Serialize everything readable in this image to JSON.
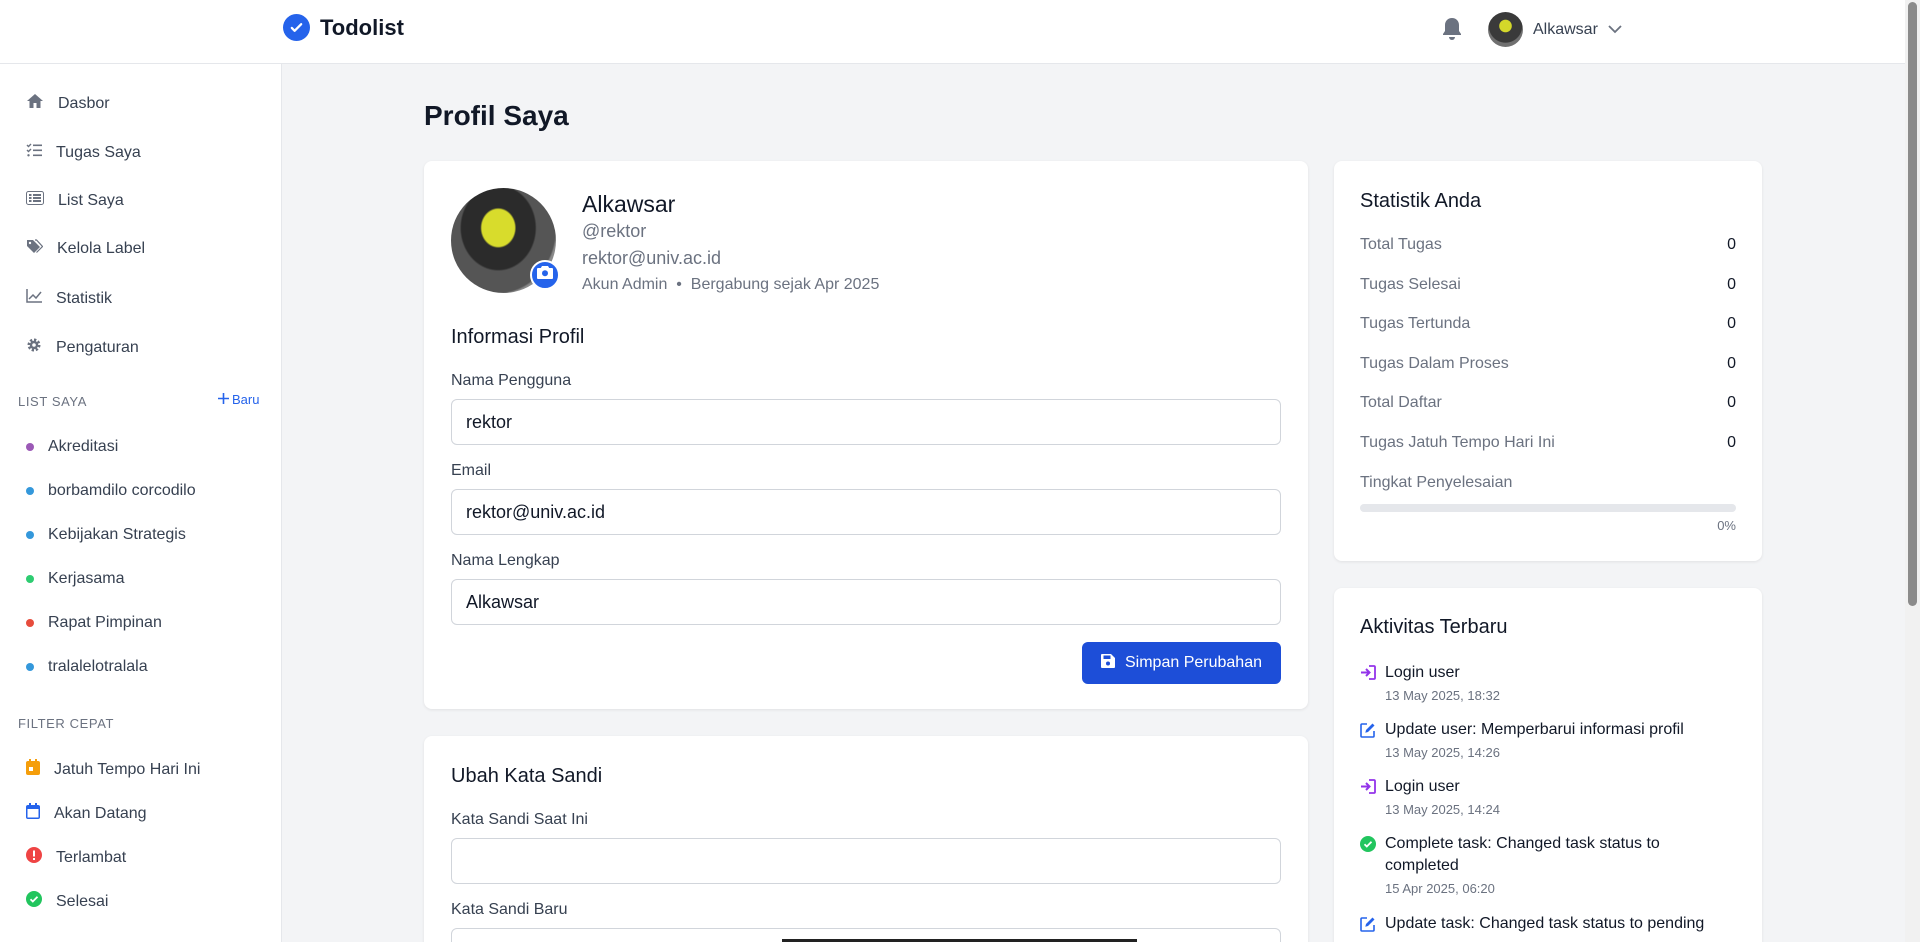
{
  "header": {
    "brand": "Todolist",
    "user_name": "Alkawsar"
  },
  "sidebar": {
    "nav": [
      {
        "label": "Dasbor",
        "icon": "home-icon"
      },
      {
        "label": "Tugas Saya",
        "icon": "tasks-icon"
      },
      {
        "label": "List Saya",
        "icon": "list-icon"
      },
      {
        "label": "Kelola Label",
        "icon": "tags-icon"
      },
      {
        "label": "Statistik",
        "icon": "chart-line-icon"
      },
      {
        "label": "Pengaturan",
        "icon": "gear-icon"
      }
    ],
    "lists_title": "LIST SAYA",
    "new_label": "Baru",
    "lists": [
      {
        "label": "Akreditasi",
        "color": "#9b59b6"
      },
      {
        "label": "borbamdilo corcodilo",
        "color": "#3498db"
      },
      {
        "label": "Kebijakan Strategis",
        "color": "#3498db"
      },
      {
        "label": "Kerjasama",
        "color": "#2ecc71"
      },
      {
        "label": "Rapat Pimpinan",
        "color": "#e74c3c"
      },
      {
        "label": "tralalelotralala",
        "color": "#3498db"
      }
    ],
    "filter_title": "FILTER CEPAT",
    "filters": [
      {
        "label": "Jatuh Tempo Hari Ini",
        "icon": "calendar-day-icon",
        "color": "#f59e0b"
      },
      {
        "label": "Akan Datang",
        "icon": "calendar-icon",
        "color": "#2563eb"
      },
      {
        "label": "Terlambat",
        "icon": "alert-icon",
        "color": "#ef4444"
      },
      {
        "label": "Selesai",
        "icon": "check-circle-icon",
        "color": "#22c55e"
      }
    ]
  },
  "main": {
    "page_title": "Profil Saya",
    "profile": {
      "name": "Alkawsar",
      "username": "@rektor",
      "email": "rektor@univ.ac.id",
      "meta": "Akun Admin  •  Bergabung sejak Apr 2025"
    },
    "info": {
      "title": "Informasi Profil",
      "username_label": "Nama Pengguna",
      "username_value": "rektor",
      "email_label": "Email",
      "email_value": "rektor@univ.ac.id",
      "fullname_label": "Nama Lengkap",
      "fullname_value": "Alkawsar",
      "save_label": "Simpan Perubahan"
    },
    "password": {
      "title": "Ubah Kata Sandi",
      "current_label": "Kata Sandi Saat Ini",
      "new_label": "Kata Sandi Baru"
    }
  },
  "stats": {
    "title": "Statistik Anda",
    "rows": [
      {
        "label": "Total Tugas",
        "value": "0"
      },
      {
        "label": "Tugas Selesai",
        "value": "0"
      },
      {
        "label": "Tugas Tertunda",
        "value": "0"
      },
      {
        "label": "Tugas Dalam Proses",
        "value": "0"
      },
      {
        "label": "Total Daftar",
        "value": "0"
      },
      {
        "label": "Tugas Jatuh Tempo Hari Ini",
        "value": "0"
      }
    ],
    "completion_label": "Tingkat Penyelesaian",
    "completion_percent": 0,
    "completion_text": "0%"
  },
  "activity": {
    "title": "Aktivitas Terbaru",
    "items": [
      {
        "title": "Login user",
        "time": "13 May 2025, 18:32",
        "icon": "sign-in-icon",
        "color": "#9333ea"
      },
      {
        "title": "Update user: Memperbarui informasi profil",
        "time": "13 May 2025, 14:26",
        "icon": "edit-icon",
        "color": "#2563eb"
      },
      {
        "title": "Login user",
        "time": "13 May 2025, 14:24",
        "icon": "sign-in-icon",
        "color": "#9333ea"
      },
      {
        "title": "Complete task: Changed task status to completed",
        "time": "15 Apr 2025, 06:20",
        "icon": "check-circle-icon",
        "color": "#22c55e"
      },
      {
        "title": "Update task: Changed task status to pending",
        "time": "",
        "icon": "edit-icon",
        "color": "#2563eb"
      }
    ]
  }
}
